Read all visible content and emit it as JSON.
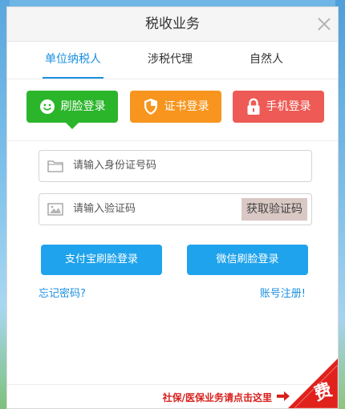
{
  "window": {
    "title": "税收业务"
  },
  "tabs": [
    {
      "label": "单位纳税人",
      "active": true
    },
    {
      "label": "涉税代理",
      "active": false
    },
    {
      "label": "自然人",
      "active": false
    }
  ],
  "login_modes": {
    "face": {
      "label": "刷脸登录",
      "color": "#2bb52b",
      "icon": "smiley-icon"
    },
    "cert": {
      "label": "证书登录",
      "color": "#f7951e",
      "icon": "shield-icon"
    },
    "phone": {
      "label": "手机登录",
      "color": "#ee5a55",
      "icon": "lock-icon"
    }
  },
  "form": {
    "id_placeholder": "请输入身份证号码",
    "code_placeholder": "请输入验证码",
    "get_code_label": "获取验证码"
  },
  "actions": {
    "alipay_label": "支付宝刷脸登录",
    "wechat_label": "微信刷脸登录"
  },
  "links": {
    "forgot": "忘记密码?",
    "register": "账号注册!"
  },
  "footer": {
    "notice": "社保/医保业务请点击这里",
    "corner_char": "费",
    "accent": "#d8201c"
  }
}
